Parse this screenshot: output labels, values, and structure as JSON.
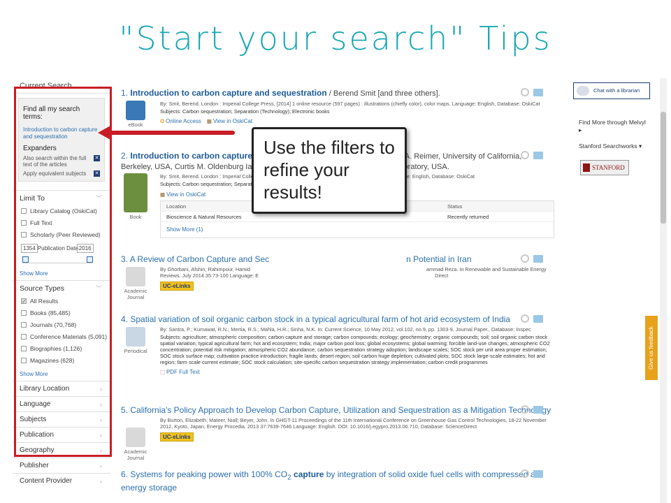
{
  "slide_title": "\"Start your search\" Tips",
  "sidebar": {
    "current_search": "Current Search",
    "find_all_title": "Find all my search terms:",
    "find_all_term": "Introduction to carbon capture and sequestration",
    "expanders_title": "Expanders",
    "expanders": [
      "Also search within the full text of the articles",
      "Apply equivalent subjects"
    ],
    "limit_to": "Limit To",
    "limit_options": [
      {
        "label": "Library Catalog (OskiCat)",
        "checked": false
      },
      {
        "label": "Full Text",
        "checked": false
      },
      {
        "label": "Scholarly (Peer Reviewed)",
        "checked": false
      }
    ],
    "date_from": "1354",
    "date_label": "Publication Date",
    "date_to": "2016",
    "show_more_1": "Show More",
    "source_types": "Source Types",
    "source_options": [
      {
        "label": "All Results",
        "checked": true
      },
      {
        "label": "Books (85,485)",
        "checked": false
      },
      {
        "label": "Journals (70,768)",
        "checked": false
      },
      {
        "label": "Conference Materials (5,091)",
        "checked": false
      },
      {
        "label": "Biographies (1,126)",
        "checked": false
      },
      {
        "label": "Magazines (628)",
        "checked": false
      }
    ],
    "show_more_2": "Show More",
    "nav": [
      "Library Location",
      "Language",
      "Subjects",
      "Publication",
      "Geography",
      "Publisher",
      "Content Provider"
    ]
  },
  "results": [
    {
      "num": "1.",
      "title": "Introduction to carbon capture and sequestration",
      "author": " / Berend Smit [and three others].",
      "byline": "By: Smit, Berend. London : Imperial College Press, [2014] 1 online resource (597 pages) : illustrations (chiefly color), color maps. Language: English, Database: OskiCat",
      "subjects": "Subjects: Carbon sequestration; Separation (Technology); Electronic books",
      "type": "eBook",
      "link1": "Online Access",
      "link2": "View in OskiCat"
    },
    {
      "num": "2.",
      "title": "Introduction to carbon capture and sequestration",
      "author": " / Berend Smit, Jeffrey A. Reimer, University of California, Berkeley, USA, Curtis M. Oldenburg Ian C. Bourg, Lawrence Berkeley National Laboratory, USA.",
      "byline": "By: Smit, Berend. London : Imperial College Press, [2014] xv, 580 pages : color illustrations ; 24 cm. Language: English, Database: OskiCat",
      "subjects": "Subjects: Carbon sequestration; Separation (Technology)",
      "type": "Book",
      "link1": "View in OskiCat",
      "holdings_head": "Location",
      "holdings_status_head": "Status",
      "holdings_location": "Bioscience & Natural Resources",
      "holdings_status": "Recently returned",
      "show_more": "Show More (1)"
    },
    {
      "num": "3.",
      "title": "A Review of Carbon Capture and Sec",
      "title_tail": "n Potential in Iran",
      "byline": "By Ghorbani, Afshin; Rahimpour, Hamid",
      "byline_tail": "ammad Reza. In Renewable and Sustainable Energy",
      "byline2": "Reviews. July 2014 35:73-100 Language: E",
      "byline2_tail": "Direct",
      "type": "Academic Journal",
      "badge": "UC-eLinks"
    },
    {
      "num": "4.",
      "title": "Spatial variation of soil organic carbon stock in a typical agricultural farm of hot arid ecosystem of India",
      "byline": "By: Santra, P.; Kumawat, R.N.; Mertia, R.S.; Mahla, H.R.; Sinha, N.K. In: Current Science, 10 May 2012, vol.102, no.9, pp. 1303-9, Journal Paper., Database: Inspec",
      "subjects": "Subjects: agriculture; atmospheric composition; carbon capture and storage; carbon compounds; ecology; geochemistry; organic compounds; soil; soil organic carbon stock spatial variation; typical agricultural farm; hot arid ecosystem; India; major carbon pool loss; global ecosystems; global warming; forcible land-use changes; atmospheric CO2 concentration; potential risk mitigation; atmospheric CO2 abundance; carbon sequestration strategy adoption; landscape scales; SOC stock per unit area proper estimation; SOC stock surface map; cultivation practice introduction; fragile lands; desert region; soil carbon huge depletion; cultivated plots; SOC stock large-scale estimates; hot arid region; farm scale current estimate; SOC stock calculation; site-specific carbon sequestration strategy implementation; carbon credit programmes",
      "type": "Periodical",
      "link1": "PDF Full Text"
    },
    {
      "num": "5.",
      "title": "California's Policy Approach to Develop Carbon Capture, Utilization and Sequestration as a Mitigation Technology",
      "byline": "By Burton, Elizabeth; Mateer, Niall; Beyer, John. In GHGT-11 Proceedings of the 11th International Conference on Greenhouse Gas Control Technologies, 18-22 November 2012, Kyoto, Japan, Energy Procedia. 2013 37:7639-7646 Language: English. DOI: 10.1016/j.egypro.2013.06.710, Database: ScienceDirect",
      "type": "Academic Journal",
      "badge": "UC-eLinks"
    },
    {
      "num": "6.",
      "title_a": "Systems for peaking power with 100% CO",
      "title_sub": "2",
      "title_b": " capture",
      "title_c": " by integration of solid oxide fuel cells with compressed air energy storage"
    }
  ],
  "callout": "Use the filters to refine your results!",
  "rail": {
    "chat": "Chat with a librarian",
    "find_more": "Find More through Melvyl ▸",
    "searchworks": "Stanford Searchworks ▾",
    "stanford": "STANFORD",
    "feedback": "Give us feedback"
  },
  "colors": {
    "title": "#18a7b5",
    "highlight": "#c81d25",
    "link": "#2c6fae"
  }
}
